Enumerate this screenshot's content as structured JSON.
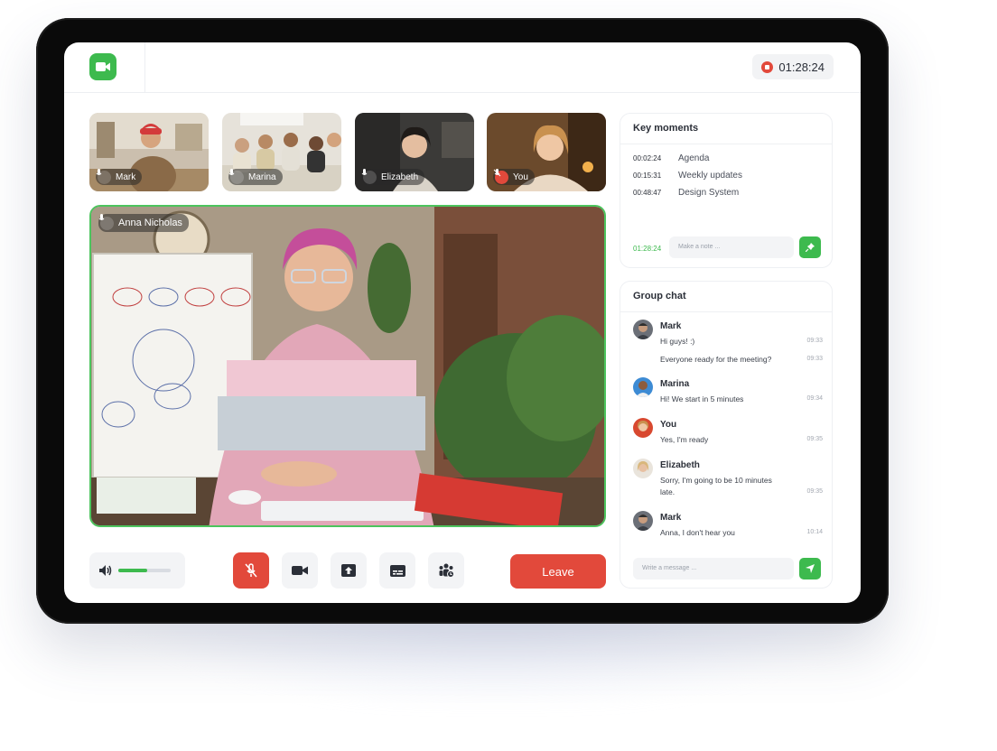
{
  "header": {
    "recording_time": "01:28:24"
  },
  "participants": [
    {
      "name": "Mark",
      "muted": false
    },
    {
      "name": "Marina",
      "muted": false
    },
    {
      "name": "Elizabeth",
      "muted": false
    },
    {
      "name": "You",
      "muted": true
    }
  ],
  "main_video": {
    "speaker": "Anna Nicholas"
  },
  "controls": {
    "volume_level": 0.55,
    "leave_label": "Leave"
  },
  "key_moments": {
    "title": "Key moments",
    "items": [
      {
        "time": "00:02:24",
        "label": "Agenda"
      },
      {
        "time": "00:15:31",
        "label": "Weekly updates"
      },
      {
        "time": "00:48:47",
        "label": "Design System"
      }
    ],
    "note_time": "01:28:24",
    "note_placeholder": "Make a note ..."
  },
  "group_chat": {
    "title": "Group chat",
    "messages": [
      {
        "name": "Mark",
        "lines": [
          {
            "text": "Hi guys! :)",
            "time": "09:33"
          },
          {
            "text": "Everyone ready for the meeting?",
            "time": "09:33"
          }
        ]
      },
      {
        "name": "Marina",
        "lines": [
          {
            "text": "Hi! We start in 5 minutes",
            "time": "09:34"
          }
        ]
      },
      {
        "name": "You",
        "lines": [
          {
            "text": "Yes, I'm ready",
            "time": "09:35"
          }
        ]
      },
      {
        "name": "Elizabeth",
        "lines": [
          {
            "text": "Sorry, I'm going to be 10 minutes",
            "time": ""
          },
          {
            "text": "late.",
            "time": "09:35"
          }
        ]
      },
      {
        "name": "Mark",
        "lines": [
          {
            "text": "Anna, I don't hear you",
            "time": "10:14"
          }
        ]
      }
    ],
    "input_placeholder": "Write a message ..."
  },
  "colors": {
    "accent_green": "#3dba4e",
    "danger_red": "#e2493b"
  },
  "icons": [
    "video-camera-icon",
    "record-stop-icon",
    "microphone-icon",
    "microphone-muted-icon",
    "volume-icon",
    "camera-icon",
    "share-screen-icon",
    "captions-icon",
    "participants-icon",
    "pin-icon",
    "send-icon"
  ]
}
